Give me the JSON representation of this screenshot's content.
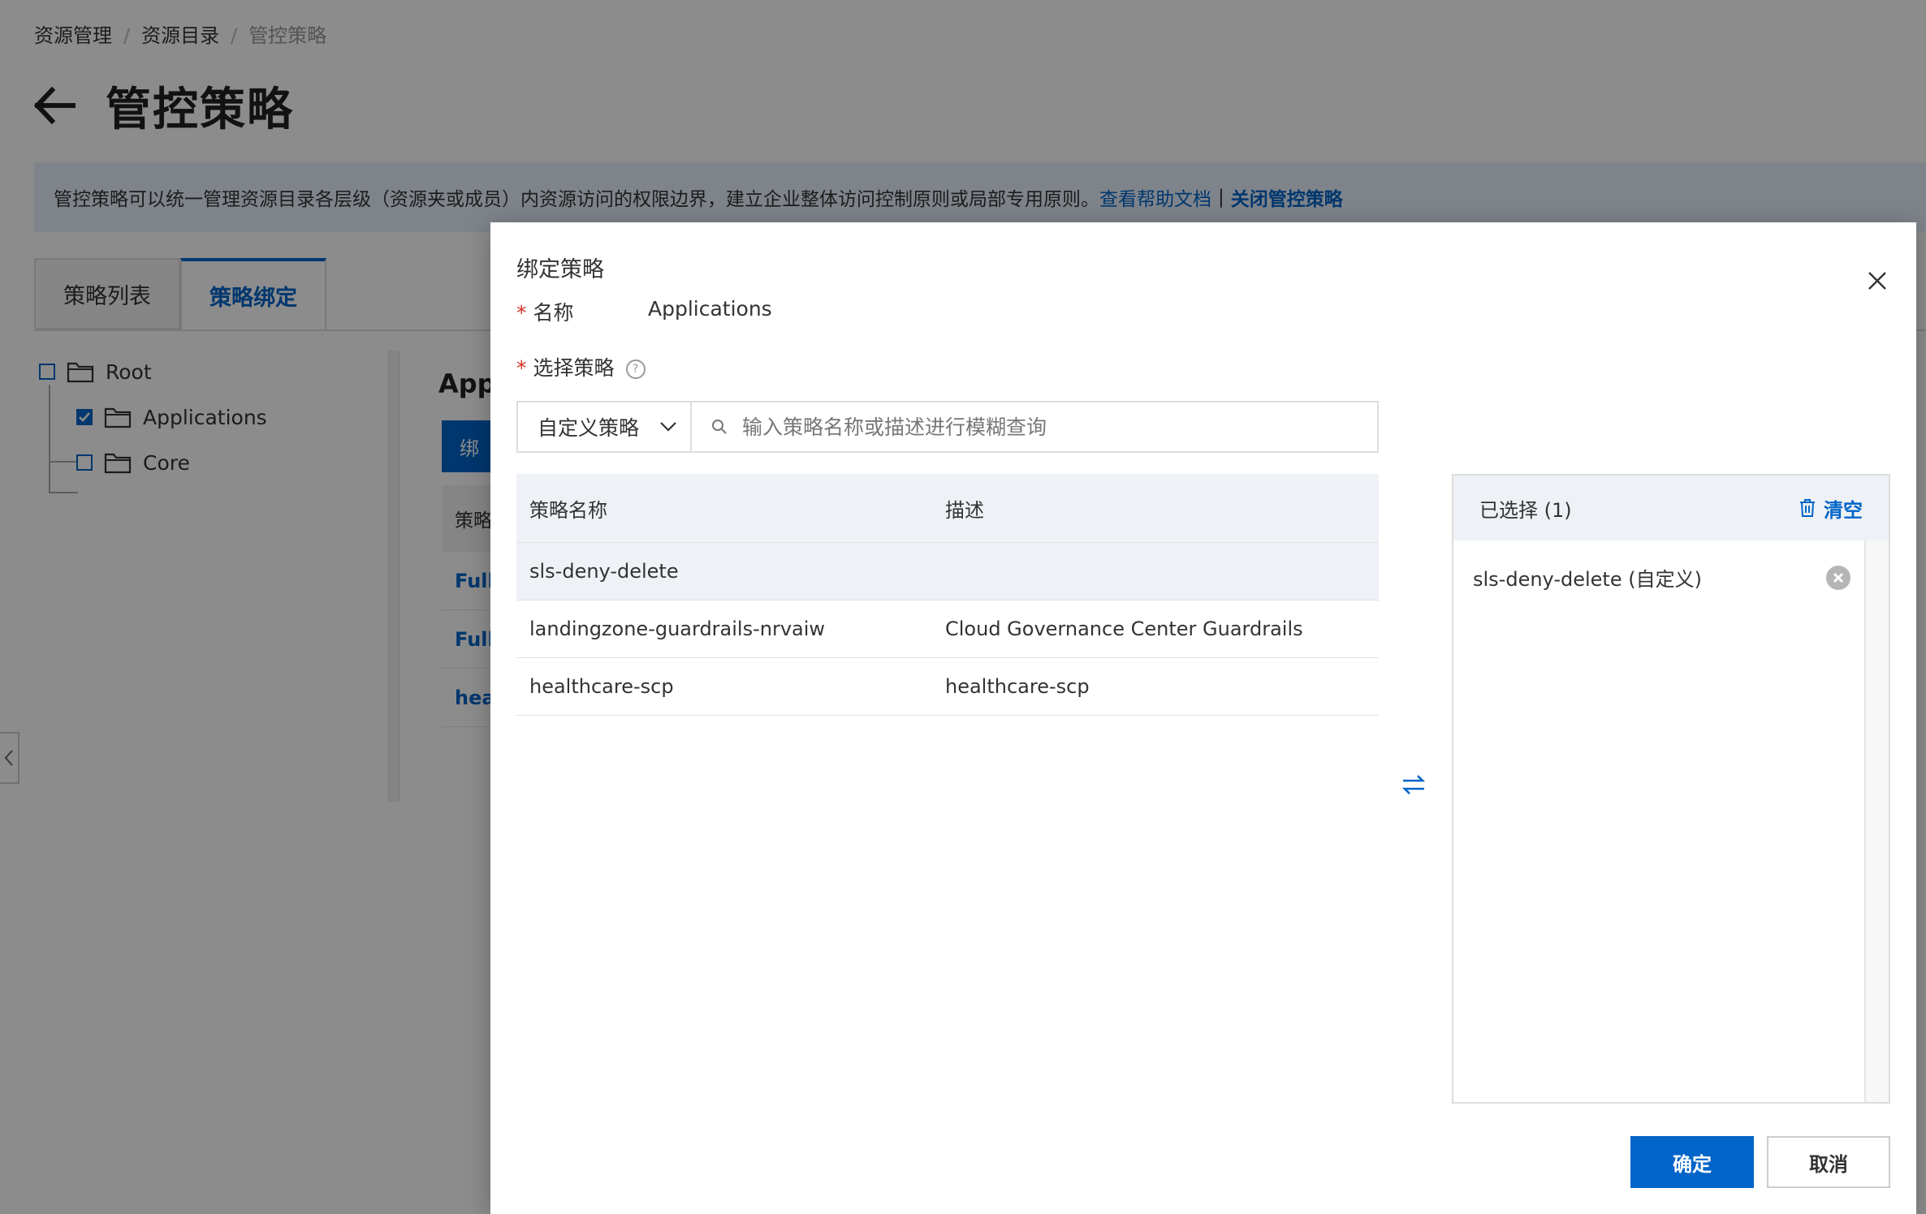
{
  "breadcrumb": {
    "item1": "资源管理",
    "item2": "资源目录",
    "current": "管控策略",
    "separator": "/"
  },
  "page": {
    "title": "管控策略"
  },
  "banner": {
    "text": "管控策略可以统一管理资源目录各层级（资源夹或成员）内资源访问的权限边界，建立企业整体访问控制原则或局部专用原则。",
    "help_link": "查看帮助文档",
    "separator": "|",
    "disable_link": "关闭管控策略"
  },
  "tabs": [
    {
      "label": "策略列表"
    },
    {
      "label": "策略绑定"
    }
  ],
  "tree": {
    "root": "Root",
    "applications": "Applications",
    "core": "Core"
  },
  "background_panel": {
    "heading": "App",
    "button": "绑",
    "column": "策略",
    "rows": [
      "Full",
      "Full",
      "hea"
    ]
  },
  "dialog": {
    "title": "绑定策略",
    "name_label": "名称",
    "name_value": "Applications",
    "policy_label": "选择策略",
    "policy_type": "自定义策略",
    "search_placeholder": "输入策略名称或描述进行模糊查询",
    "columns": {
      "name": "策略名称",
      "description": "描述"
    },
    "rows": [
      {
        "name": "sls-deny-delete",
        "description": ""
      },
      {
        "name": "landingzone-guardrails-nrvaiw",
        "description": "Cloud Governance Center Guardrails"
      },
      {
        "name": "healthcare-scp",
        "description": "healthcare-scp"
      }
    ],
    "selected_title": "已选择 (1)",
    "clear_label": "清空",
    "selected_items": [
      {
        "label": "sls-deny-delete (自定义)"
      }
    ],
    "ok_label": "确定",
    "cancel_label": "取消"
  },
  "colors": {
    "accent": "#0064c8",
    "required": "#d93026",
    "banner_bg": "#e8f1fd"
  }
}
